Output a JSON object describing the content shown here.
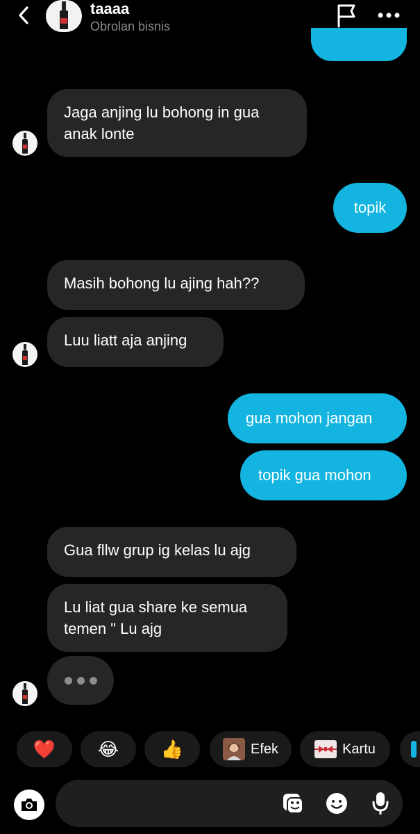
{
  "header": {
    "title": "taaaa",
    "subtitle": "Obrolan bisnis"
  },
  "messages": [
    {
      "side": "in",
      "text": "Jaga anjing lu bohong in gua anak lonte"
    },
    {
      "side": "out",
      "text": "topik"
    },
    {
      "side": "in",
      "text": "Masih bohong lu ajing hah??"
    },
    {
      "side": "in",
      "text": "Luu liatt aja anjing"
    },
    {
      "side": "out",
      "text": "gua mohon jangan"
    },
    {
      "side": "out",
      "text": "topik gua mohon"
    },
    {
      "side": "in",
      "text": "Gua fllw grup ig kelas lu ajg"
    },
    {
      "side": "in",
      "text": "Lu liat gua share ke semua temen \" Lu ajg"
    }
  ],
  "reactions": {
    "heart": "❤️",
    "laugh": "😂",
    "thumbs": "👍",
    "effects_label": "Efek",
    "cards_label": "Kartu"
  },
  "colors": {
    "outgoing_bubble": "#13b5e0",
    "incoming_bubble": "#262626",
    "background": "#000000"
  },
  "icons": [
    "back-arrow-icon",
    "flag-icon",
    "more-icon",
    "camera-icon",
    "sticker-icon",
    "emoji-icon",
    "microphone-icon"
  ]
}
